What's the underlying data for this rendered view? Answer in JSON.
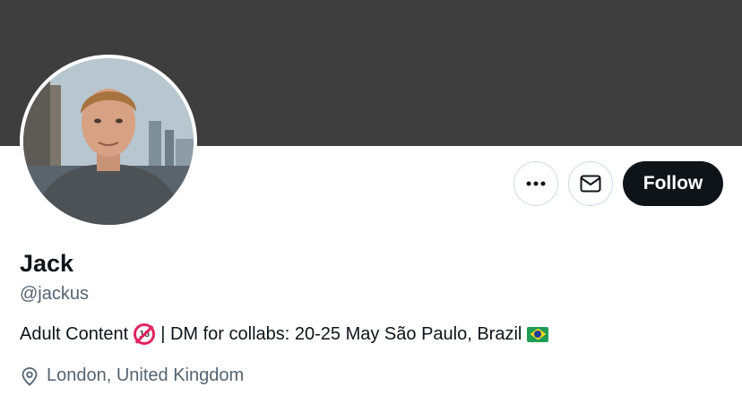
{
  "profile": {
    "name": "Jack",
    "handle": "@jackus",
    "bio_text_1": "Adult Content",
    "bio_adult_emoji": "🔞",
    "bio_text_2": "| DM for collabs: 20-25 May São Paulo, Brazil",
    "bio_flag_emoji": "🇧🇷",
    "location": "London, United Kingdom"
  },
  "actions": {
    "more_icon": "more-horizontal-icon",
    "message_icon": "envelope-icon",
    "follow_label": "Follow"
  },
  "colors": {
    "banner": "#3e3e3e",
    "follow_bg": "#0f1419",
    "secondary_text": "#536471"
  }
}
